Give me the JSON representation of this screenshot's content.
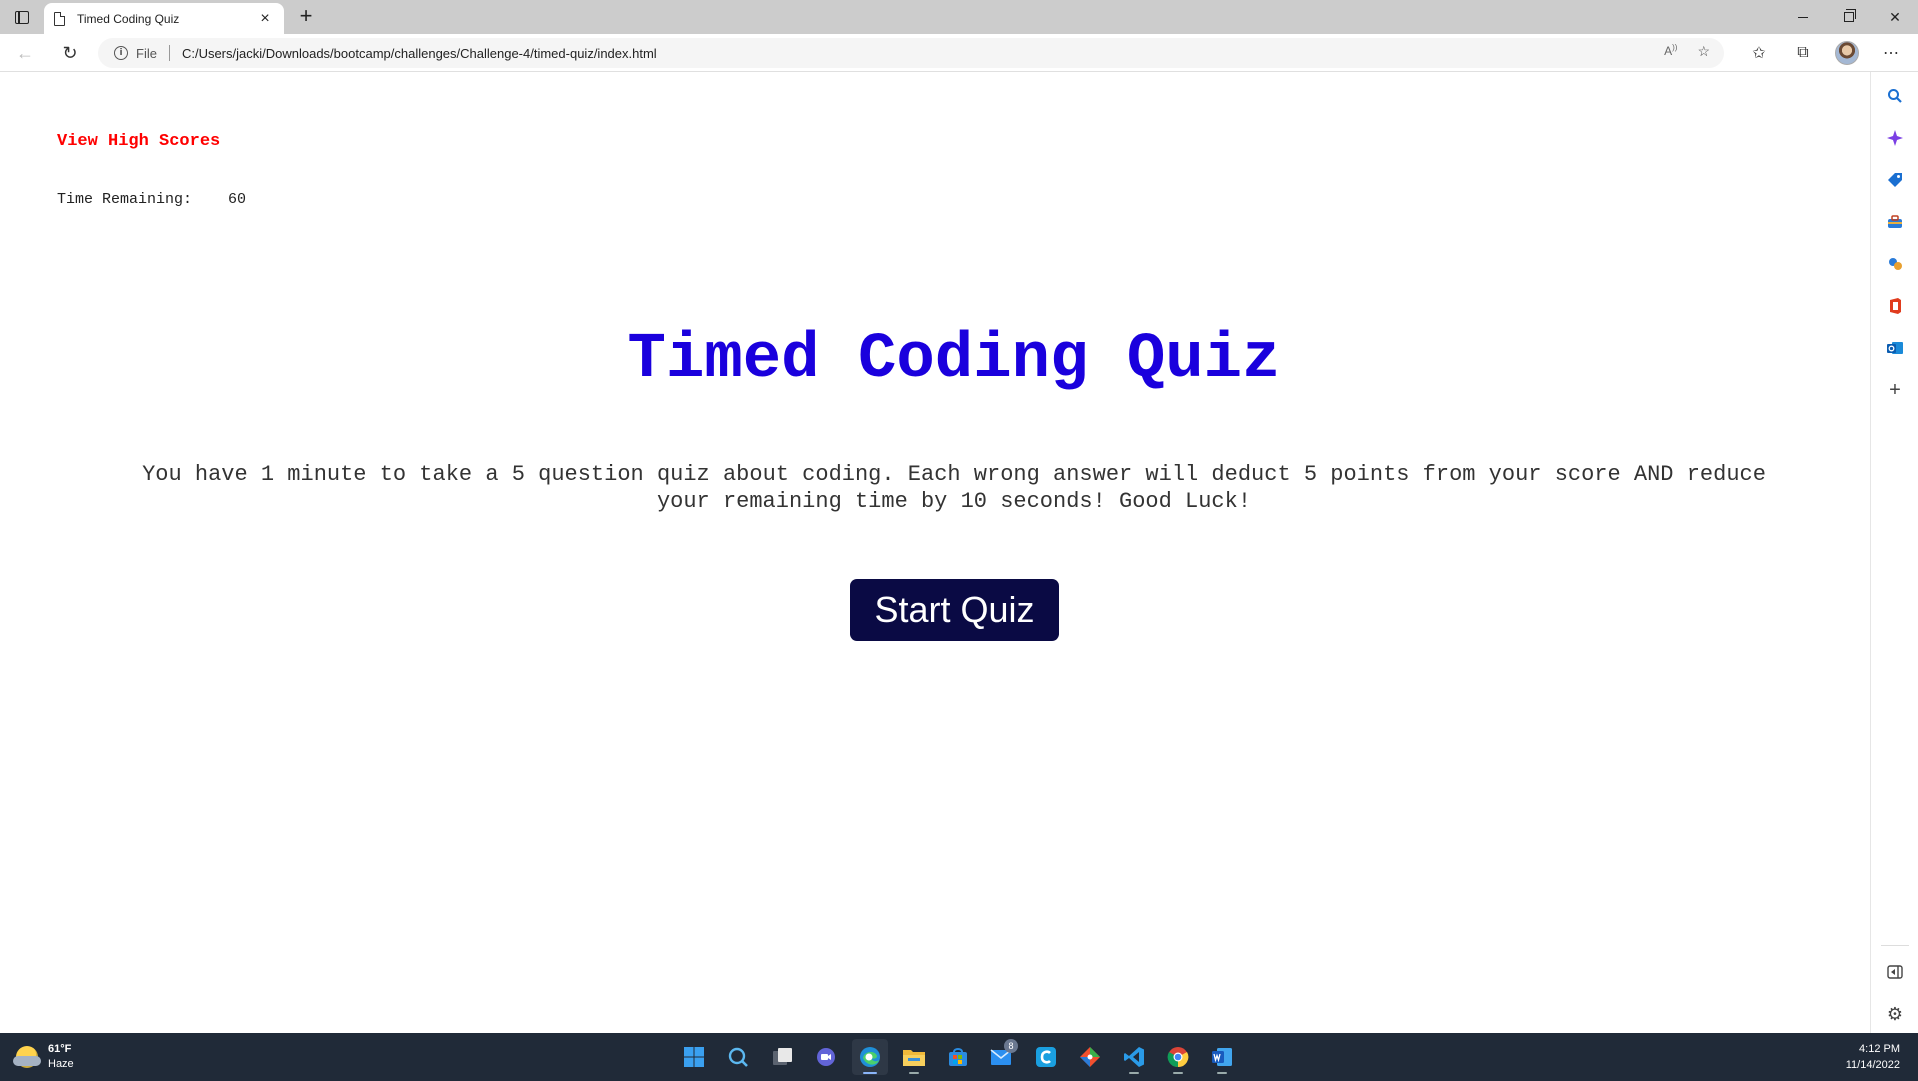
{
  "browser": {
    "tab_title": "Timed Coding Quiz",
    "new_tab_symbol": "+",
    "close_symbol": "×",
    "address": {
      "scheme_label": "File",
      "url": "C:/Users/jacki/Downloads/bootcamp/challenges/Challenge-4/timed-quiz/index.html"
    },
    "sidebar_icons": [
      "search-icon",
      "copilot-icon",
      "shopping-tag-icon",
      "tools-icon",
      "games-icon",
      "office-icon",
      "outlook-icon",
      "add-icon",
      "hide-sidebar-icon",
      "settings-icon"
    ]
  },
  "page": {
    "high_scores_link": "View High Scores",
    "timer_label": "Time Remaining:",
    "timer_value": "60",
    "title": "Timed Coding Quiz",
    "description": "You have 1 minute to take a 5 question quiz about coding. Each wrong answer will deduct 5 points from your score AND reduce your remaining time by 10 seconds! Good Luck!",
    "start_button": "Start Quiz"
  },
  "taskbar": {
    "weather_temp": "61°F",
    "weather_desc": "Haze",
    "mail_badge": "8",
    "time": "4:12 PM",
    "date": "11/14/2022",
    "apps": [
      "start-icon",
      "search-icon",
      "task-view-icon",
      "teams-chat-icon",
      "edge-icon",
      "file-explorer-icon",
      "store-icon",
      "mail-icon",
      "c-app-icon",
      "git-icon",
      "vscode-icon",
      "chrome-icon",
      "word-icon"
    ]
  },
  "colors": {
    "title": "#1a00dd",
    "high_scores": "#ff0000",
    "button_bg": "#0a0a44",
    "taskbar": "#202a38"
  }
}
